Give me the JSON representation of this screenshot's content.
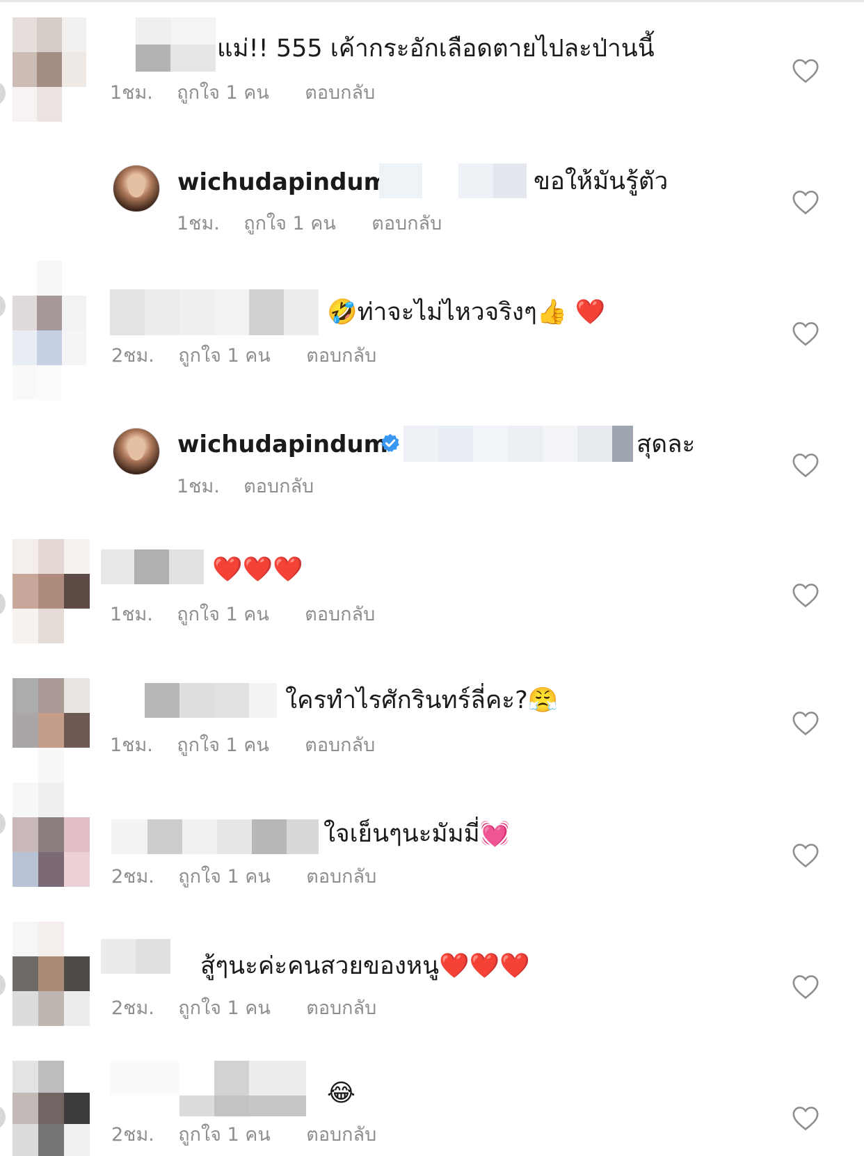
{
  "comments": [
    {
      "text": "แม่!! 555 เค้ากระอักเลือดตายไปละป่านนี้",
      "time": "1ชม.",
      "likes": "ถูกใจ 1 คน",
      "reply": "ตอบกลับ"
    },
    {
      "username": "wichudapindum",
      "text": "ขอให้มันรู้ตัว",
      "time": "1ชม.",
      "likes": "ถูกใจ 1 คน",
      "reply": "ตอบกลับ"
    },
    {
      "text": "🤣ท่าจะไม่ไหวจริงๆ👍 ❤️",
      "time": "2ชม.",
      "likes": "ถูกใจ 1 คน",
      "reply": "ตอบกลับ"
    },
    {
      "username": "wichudapindum",
      "text": "สุดละ",
      "time": "1ชม.",
      "reply": "ตอบกลับ"
    },
    {
      "text": "❤️❤️❤️",
      "time": "1ชม.",
      "likes": "ถูกใจ 1 คน",
      "reply": "ตอบกลับ"
    },
    {
      "text": "ใครทำไรศักรินทร์ลี่คะ?😤",
      "time": "1ชม.",
      "likes": "ถูกใจ 1 คน",
      "reply": "ตอบกลับ"
    },
    {
      "text": "ใจเย็นๆนะมัมมี่💓",
      "time": "2ชม.",
      "likes": "ถูกใจ 1 คน",
      "reply": "ตอบกลับ"
    },
    {
      "text": "สู้ๆนะค่ะคนสวยของหนู❤️❤️❤️",
      "time": "2ชม.",
      "likes": "ถูกใจ 1 คน",
      "reply": "ตอบกลับ"
    },
    {
      "text": "😂",
      "time": "2ชม.",
      "likes": "ถูกใจ 1 คน",
      "reply": "ตอบกลับ"
    }
  ],
  "colors": {
    "text": "#1a1a1a",
    "meta": "#8e8e8e",
    "verified": "#3897f0",
    "heart_stroke": "#8e8e8e"
  },
  "icons": {
    "like": "heart-outline-icon",
    "verified": "verified-badge-icon"
  }
}
